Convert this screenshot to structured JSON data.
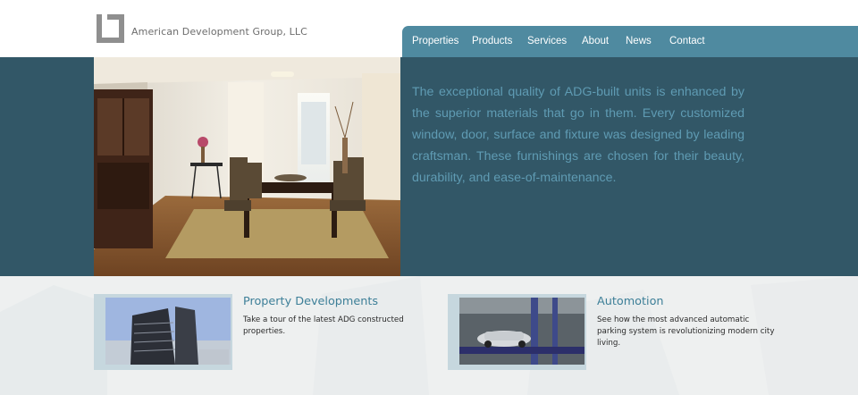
{
  "brand": {
    "name": "American Development Group, LLC"
  },
  "nav": {
    "items": [
      "Properties",
      "Products",
      "Services",
      "About",
      "News",
      "Contact"
    ]
  },
  "hero": {
    "text": "The exceptional quality of ADG-built units is enhanced by the superior materials that go in them. Every customized window, door, surface and fixture was designed by leading craftsman. These furnishings are chosen for their beauty, durability, and ease-of-maintenance."
  },
  "features": [
    {
      "title": "Property Developments",
      "description": "Take a tour of the latest ADG constructed properties."
    },
    {
      "title": "Automotion",
      "description": "See how the most advanced automatic parking system is revolutionizing modern city living."
    }
  ],
  "colors": {
    "nav_bg": "#4f8aa0",
    "band_bg": "#325767",
    "hero_text": "#5f9bb3",
    "feature_title": "#3d7f98"
  }
}
